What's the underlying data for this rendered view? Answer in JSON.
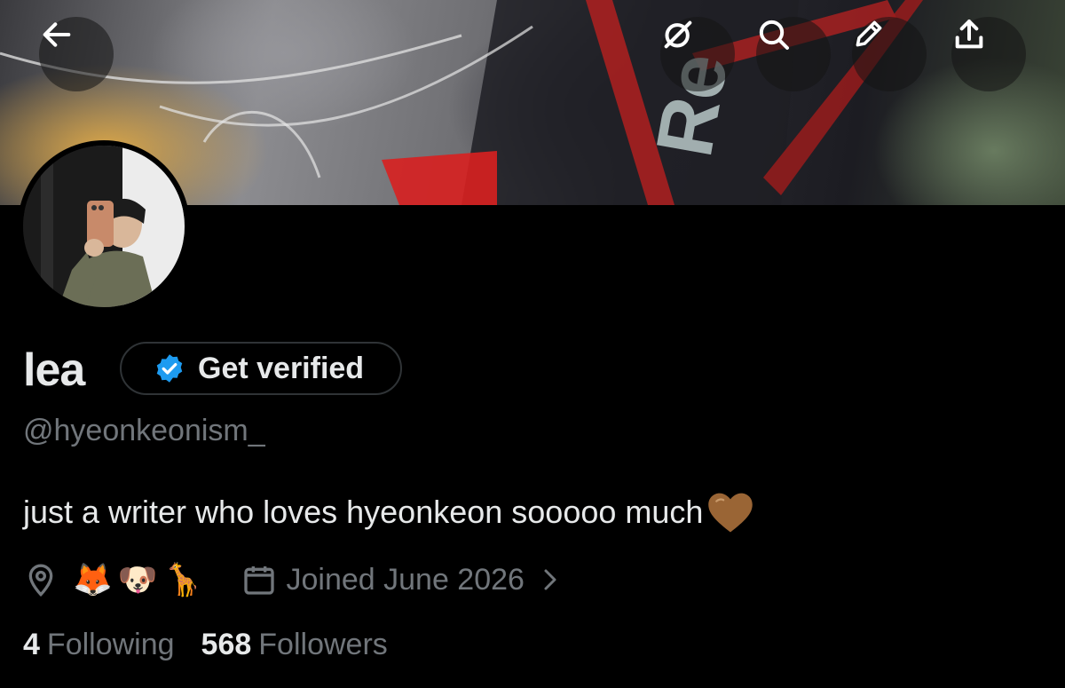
{
  "banner": {
    "icons": [
      "back-arrow-icon",
      "grok-icon",
      "search-icon",
      "edit-pencil-icon",
      "share-upload-icon"
    ]
  },
  "profile": {
    "name": "lea",
    "verify_label": "Get verified",
    "handle": "@hyeonkeonism_",
    "bio": "just a writer who loves hyeonkeon sooooo much",
    "bio_emoji": "brown-heart",
    "location_emojis": [
      "🦊",
      "🐶",
      "🦒"
    ],
    "joined": "Joined June 2026"
  },
  "stats": {
    "following_count": "4",
    "following_label": "Following",
    "followers_count": "568",
    "followers_label": "Followers"
  },
  "colors": {
    "background": "#000000",
    "primary_text": "#e7e9ea",
    "secondary_text": "#71767b",
    "verified_blue": "#1d9bf0",
    "heart_brown": "#9a6535"
  }
}
